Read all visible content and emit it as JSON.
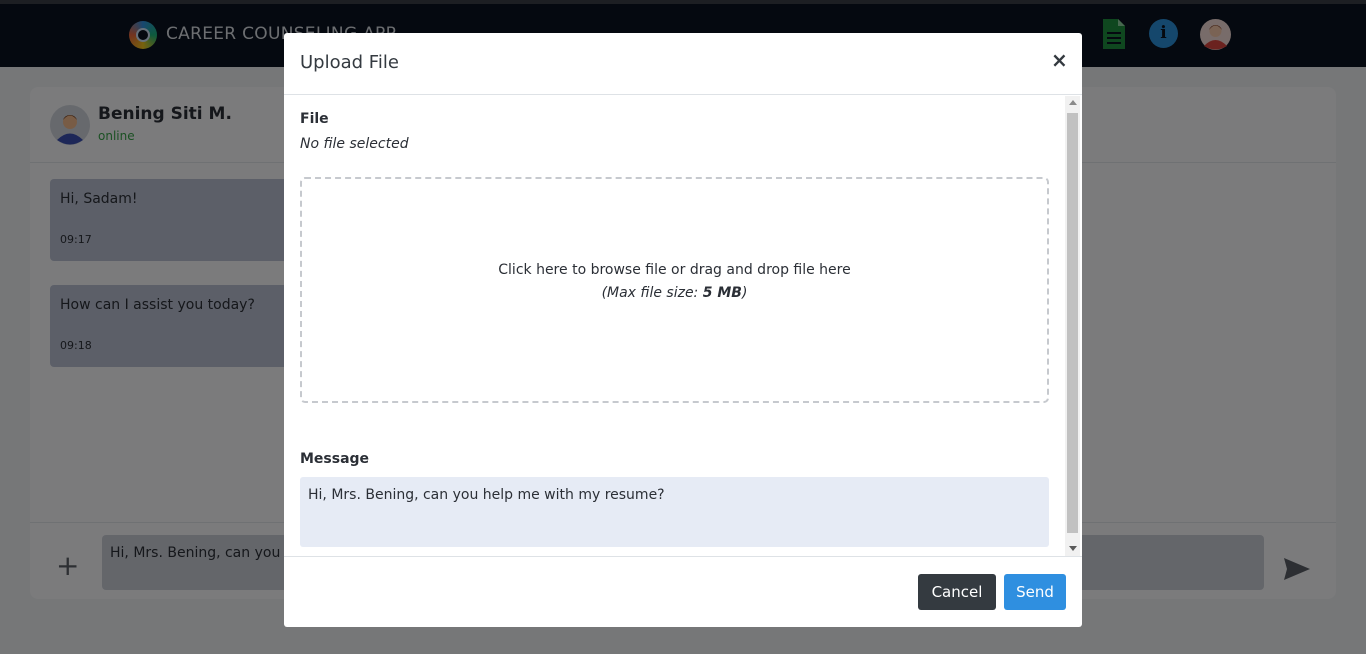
{
  "navbar": {
    "brand": "CAREER COUNSELING APP",
    "icons": [
      "logo-icon",
      "document-icon",
      "info-icon",
      "user-avatar-icon"
    ]
  },
  "chat": {
    "contact_name": "Bening Siti M.",
    "contact_status": "online",
    "messages": [
      {
        "text": "Hi, Sadam!",
        "time": "09:17"
      },
      {
        "text": "How can I assist you today?",
        "time": "09:18"
      }
    ],
    "input_value": "Hi, Mrs. Bening, can you help me with my resume?"
  },
  "modal": {
    "title": "Upload File",
    "close_label": "×",
    "file_label": "File",
    "file_status": "No file selected",
    "drop_text": "Click here to browse file or drag and drop file here",
    "drop_sub_prefix": "(Max file size: ",
    "drop_sub_size": "5 MB",
    "drop_sub_suffix": ")",
    "message_label": "Message",
    "message_value": "Hi, Mrs. Bening, can you help me with my resume?",
    "cancel_label": "Cancel",
    "send_label": "Send"
  },
  "colors": {
    "navbar": "#0b1320",
    "send_button": "#2f8fe0",
    "cancel_button": "#343a40",
    "online": "#37a146",
    "message_bubble": "#b9bfd0"
  }
}
